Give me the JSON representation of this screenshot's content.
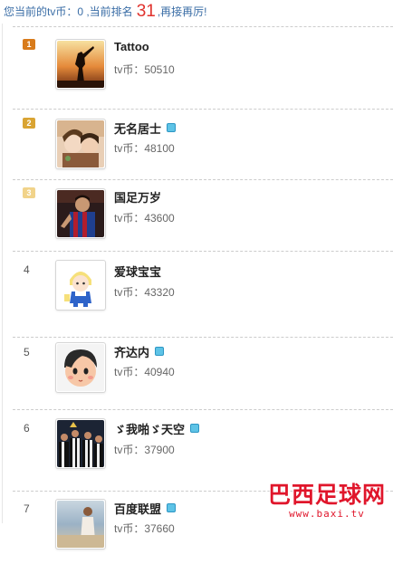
{
  "status": {
    "prefix": "您当前的tv币：0 ,当前排名",
    "rank": "31",
    "suffix": ",再接再厉!"
  },
  "colors": {
    "link_blue": "#3a6da6",
    "rank_red": "#e0322d",
    "vip_badge": "#5ec3e6",
    "watermark_red": "#e0162b"
  },
  "rows": [
    {
      "rank": "1",
      "rank_style": "gold-medal",
      "name": "Tattoo",
      "vip": false,
      "coins": "tv币：50510",
      "avatar": "avatar-silhouette-sunset"
    },
    {
      "rank": "2",
      "rank_style": "silver-medal",
      "name": "无名居士",
      "vip": true,
      "coins": "tv币：48100",
      "avatar": "avatar-anime-girl"
    },
    {
      "rank": "3",
      "rank_style": "bronze-medal",
      "name": "国足万岁",
      "vip": false,
      "coins": "tv币：43600",
      "avatar": "avatar-footballer"
    },
    {
      "rank": "4",
      "rank_style": "plain",
      "name": "爱球宝宝",
      "vip": false,
      "coins": "tv币：43320",
      "avatar": "avatar-cartoon-fan"
    },
    {
      "rank": "5",
      "rank_style": "plain",
      "name": "齐达内",
      "vip": true,
      "coins": "tv币：40940",
      "avatar": "avatar-cartoon-face"
    },
    {
      "rank": "6",
      "rank_style": "plain",
      "name": "ゞ我啪ゞ天空",
      "vip": true,
      "coins": "tv币：37900",
      "avatar": "avatar-team-celebration"
    },
    {
      "rank": "7",
      "rank_style": "plain",
      "name": "百度联盟",
      "vip": true,
      "coins": "tv币：37660",
      "avatar": "avatar-beach-photo"
    }
  ],
  "watermark": {
    "cn": "巴西足球网",
    "url": "www.baxi.tv"
  }
}
